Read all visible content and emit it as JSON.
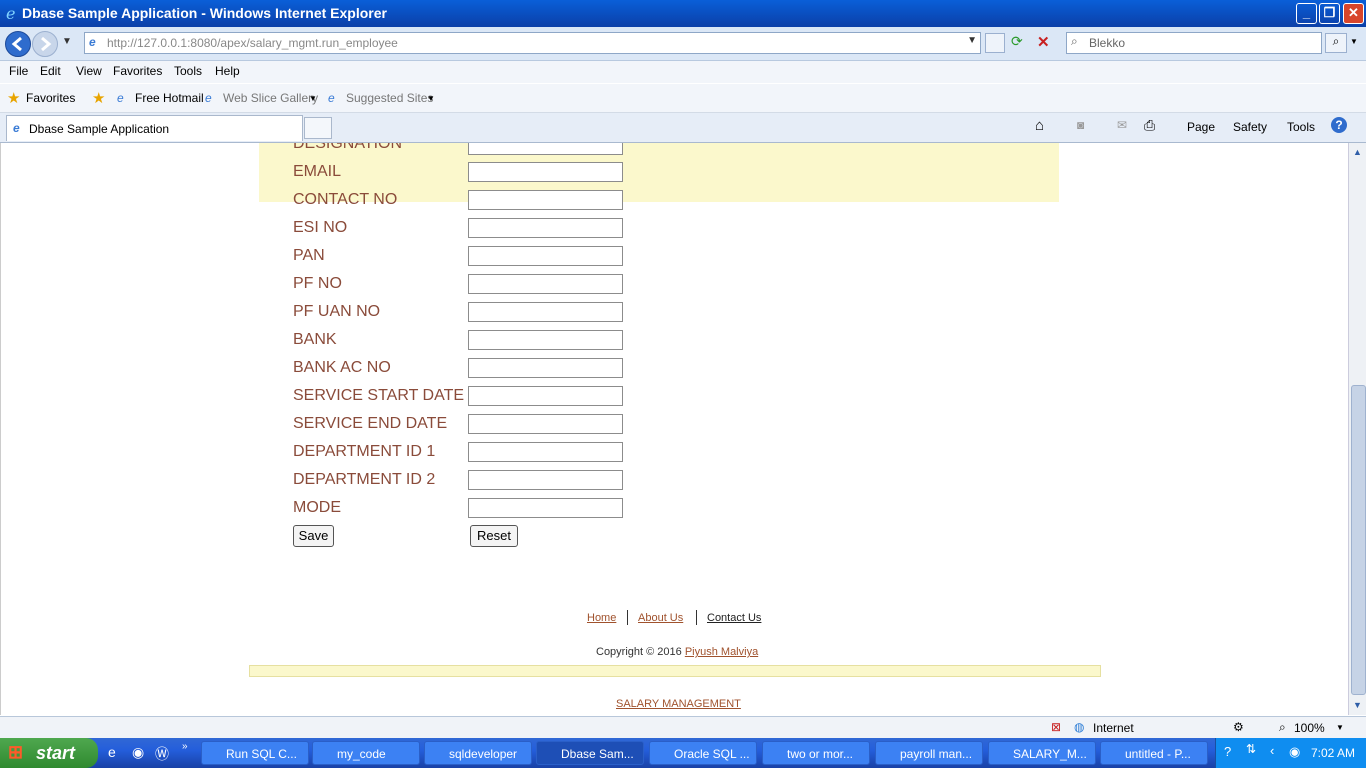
{
  "window": {
    "title": "Dbase Sample Application - Windows Internet Explorer"
  },
  "address_bar": {
    "url": "http://127.0.0.1:8080/apex/salary_mgmt.run_employee"
  },
  "search": {
    "placeholder": "Blekko"
  },
  "menu": [
    "File",
    "Edit",
    "View",
    "Favorites",
    "Tools",
    "Help"
  ],
  "favorites_bar": {
    "favorites_label": "Favorites",
    "links": [
      "Free Hotmail",
      "Web Slice Gallery",
      "Suggested Sites"
    ]
  },
  "tab": {
    "title": "Dbase Sample Application"
  },
  "command_bar": [
    "Page",
    "Safety",
    "Tools"
  ],
  "form": {
    "fields": [
      {
        "label": "DESIGNATION",
        "value": ""
      },
      {
        "label": "EMAIL",
        "value": ""
      },
      {
        "label": "CONTACT NO",
        "value": ""
      },
      {
        "label": "ESI NO",
        "value": ""
      },
      {
        "label": "PAN",
        "value": ""
      },
      {
        "label": "PF NO",
        "value": ""
      },
      {
        "label": "PF UAN NO",
        "value": ""
      },
      {
        "label": "BANK",
        "value": ""
      },
      {
        "label": "BANK AC NO",
        "value": ""
      },
      {
        "label": "SERVICE START DATE",
        "value": ""
      },
      {
        "label": "SERVICE END DATE",
        "value": ""
      },
      {
        "label": "DEPARTMENT ID 1",
        "value": ""
      },
      {
        "label": "DEPARTMENT ID 2",
        "value": ""
      },
      {
        "label": "MODE",
        "value": ""
      }
    ],
    "save_label": "Save",
    "reset_label": "Reset"
  },
  "footer": {
    "links": [
      "Home",
      "About Us",
      "Contact Us"
    ],
    "copyright_prefix": "Copyright © 2016",
    "author": "Piyush Malviya",
    "bottom_link": "SALARY MANAGEMENT"
  },
  "status_bar": {
    "zone": "Internet",
    "zoom": "100%"
  },
  "taskbar": {
    "start_label": "start",
    "tasks": [
      "Run SQL C...",
      "my_code",
      "sqldeveloper",
      "Dbase Sam...",
      "Oracle SQL ...",
      "two or mor...",
      "payroll man...",
      "SALARY_M...",
      "untitled - P..."
    ],
    "clock": "7:02 AM"
  }
}
